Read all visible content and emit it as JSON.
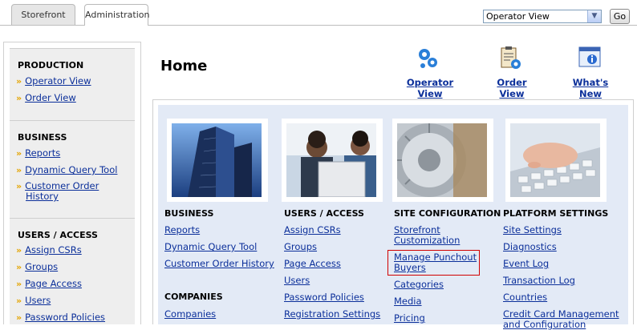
{
  "tabs": {
    "storefront": "Storefront",
    "administration": "Administration"
  },
  "view_select": {
    "value": "Operator View",
    "go_label": "Go"
  },
  "sidebar": {
    "production": {
      "heading": "PRODUCTION",
      "items": [
        "Operator View",
        "Order View"
      ]
    },
    "business": {
      "heading": "BUSINESS",
      "items": [
        "Reports",
        "Dynamic Query Tool",
        "Customer Order History"
      ]
    },
    "users_access": {
      "heading": "USERS / ACCESS",
      "items": [
        "Assign CSRs",
        "Groups",
        "Page Access",
        "Users",
        "Password Policies"
      ]
    }
  },
  "page": {
    "title": "Home"
  },
  "quick_links": {
    "operator_view": "Operator View",
    "order_view": "Order View",
    "whats_new": "What's New"
  },
  "sections": {
    "business": {
      "heading": "BUSINESS",
      "links": [
        "Reports",
        "Dynamic Query Tool",
        "Customer Order History"
      ]
    },
    "companies": {
      "heading": "COMPANIES",
      "links": [
        "Companies"
      ]
    },
    "users_access": {
      "heading": "USERS / ACCESS",
      "links": [
        "Assign CSRs",
        "Groups",
        "Page Access",
        "Users",
        "Password Policies",
        "Registration Settings"
      ]
    },
    "site_configuration": {
      "heading": "SITE CONFIGURATION",
      "links": [
        "Storefront Customization",
        "Manage Punchout Buyers",
        "Categories",
        "Media",
        "Pricing"
      ]
    },
    "platform_settings": {
      "heading": "PLATFORM SETTINGS",
      "links": [
        "Site Settings",
        "Diagnostics",
        "Event Log",
        "Transaction Log",
        "Countries",
        "Credit Card Management and Configuration"
      ]
    }
  },
  "colors": {
    "link": "#0b2f9a",
    "bullet": "#e3a400",
    "panel": "#e3eaf6",
    "highlight": "#d10000"
  }
}
